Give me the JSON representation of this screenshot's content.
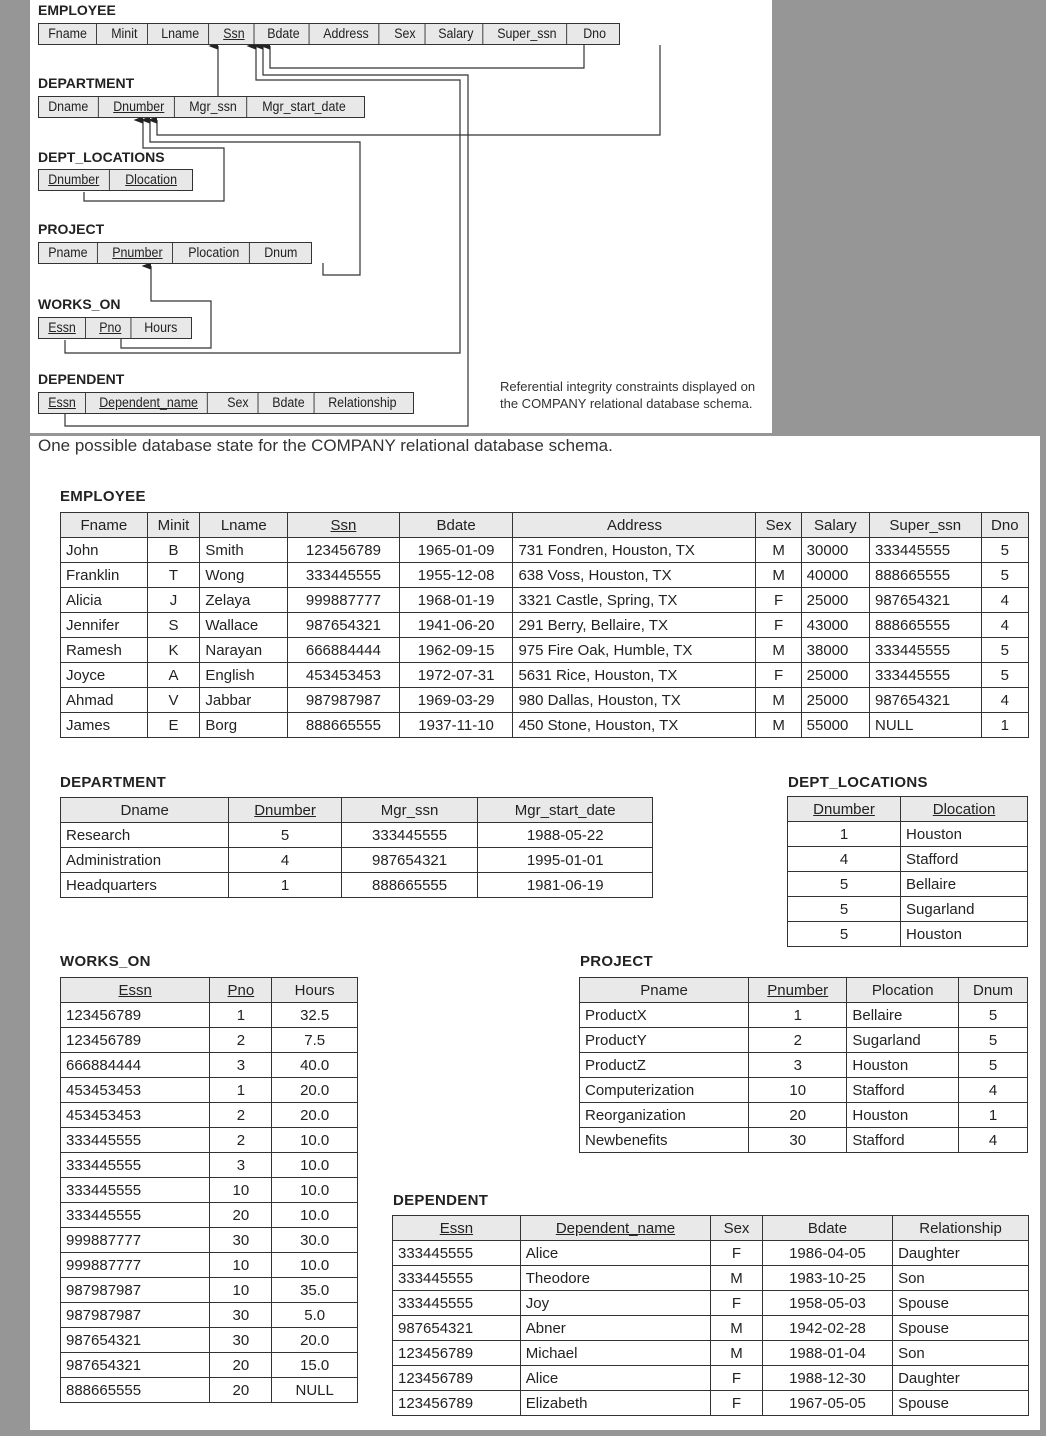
{
  "schema": {
    "caption": "Referential integrity constraints displayed on the COMPANY relational database schema.",
    "relations": [
      {
        "name": "EMPLOYEE",
        "attributes": [
          "Fname",
          "Minit",
          "Lname",
          "Ssn",
          "Bdate",
          "Address",
          "Sex",
          "Salary",
          "Super_ssn",
          "Dno"
        ],
        "keys": [
          "Ssn"
        ]
      },
      {
        "name": "DEPARTMENT",
        "attributes": [
          "Dname",
          "Dnumber",
          "Mgr_ssn",
          "Mgr_start_date"
        ],
        "keys": [
          "Dnumber"
        ]
      },
      {
        "name": "DEPT_LOCATIONS",
        "attributes": [
          "Dnumber",
          "Dlocation"
        ],
        "keys": [
          "Dnumber",
          "Dlocation"
        ]
      },
      {
        "name": "PROJECT",
        "attributes": [
          "Pname",
          "Pnumber",
          "Plocation",
          "Dnum"
        ],
        "keys": [
          "Pnumber"
        ]
      },
      {
        "name": "WORKS_ON",
        "attributes": [
          "Essn",
          "Pno",
          "Hours"
        ],
        "keys": [
          "Essn",
          "Pno"
        ]
      },
      {
        "name": "DEPENDENT",
        "attributes": [
          "Essn",
          "Dependent_name",
          "Sex",
          "Bdate",
          "Relationship"
        ],
        "keys": [
          "Essn",
          "Dependent_name"
        ]
      }
    ]
  },
  "state": {
    "caption": "One possible database state for the COMPANY relational database schema.",
    "employee": {
      "title": "EMPLOYEE",
      "headers": [
        "Fname",
        "Minit",
        "Lname",
        "Ssn",
        "Bdate",
        "Address",
        "Sex",
        "Salary",
        "Super_ssn",
        "Dno"
      ],
      "rows": [
        [
          "John",
          "B",
          "Smith",
          "123456789",
          "1965-01-09",
          "731 Fondren, Houston, TX",
          "M",
          "30000",
          "333445555",
          "5"
        ],
        [
          "Franklin",
          "T",
          "Wong",
          "333445555",
          "1955-12-08",
          "638 Voss, Houston, TX",
          "M",
          "40000",
          "888665555",
          "5"
        ],
        [
          "Alicia",
          "J",
          "Zelaya",
          "999887777",
          "1968-01-19",
          "3321 Castle, Spring, TX",
          "F",
          "25000",
          "987654321",
          "4"
        ],
        [
          "Jennifer",
          "S",
          "Wallace",
          "987654321",
          "1941-06-20",
          "291 Berry, Bellaire, TX",
          "F",
          "43000",
          "888665555",
          "4"
        ],
        [
          "Ramesh",
          "K",
          "Narayan",
          "666884444",
          "1962-09-15",
          "975 Fire Oak, Humble, TX",
          "M",
          "38000",
          "333445555",
          "5"
        ],
        [
          "Joyce",
          "A",
          "English",
          "453453453",
          "1972-07-31",
          "5631 Rice, Houston, TX",
          "F",
          "25000",
          "333445555",
          "5"
        ],
        [
          "Ahmad",
          "V",
          "Jabbar",
          "987987987",
          "1969-03-29",
          "980 Dallas, Houston, TX",
          "M",
          "25000",
          "987654321",
          "4"
        ],
        [
          "James",
          "E",
          "Borg",
          "888665555",
          "1937-11-10",
          "450 Stone, Houston, TX",
          "M",
          "55000",
          "NULL",
          "1"
        ]
      ]
    },
    "department": {
      "title": "DEPARTMENT",
      "headers": [
        "Dname",
        "Dnumber",
        "Mgr_ssn",
        "Mgr_start_date"
      ],
      "rows": [
        [
          "Research",
          "5",
          "333445555",
          "1988-05-22"
        ],
        [
          "Administration",
          "4",
          "987654321",
          "1995-01-01"
        ],
        [
          "Headquarters",
          "1",
          "888665555",
          "1981-06-19"
        ]
      ]
    },
    "dept_locations": {
      "title": "DEPT_LOCATIONS",
      "headers": [
        "Dnumber",
        "Dlocation"
      ],
      "rows": [
        [
          "1",
          "Houston"
        ],
        [
          "4",
          "Stafford"
        ],
        [
          "5",
          "Bellaire"
        ],
        [
          "5",
          "Sugarland"
        ],
        [
          "5",
          "Houston"
        ]
      ]
    },
    "works_on": {
      "title": "WORKS_ON",
      "headers": [
        "Essn",
        "Pno",
        "Hours"
      ],
      "rows": [
        [
          "123456789",
          "1",
          "32.5"
        ],
        [
          "123456789",
          "2",
          "7.5"
        ],
        [
          "666884444",
          "3",
          "40.0"
        ],
        [
          "453453453",
          "1",
          "20.0"
        ],
        [
          "453453453",
          "2",
          "20.0"
        ],
        [
          "333445555",
          "2",
          "10.0"
        ],
        [
          "333445555",
          "3",
          "10.0"
        ],
        [
          "333445555",
          "10",
          "10.0"
        ],
        [
          "333445555",
          "20",
          "10.0"
        ],
        [
          "999887777",
          "30",
          "30.0"
        ],
        [
          "999887777",
          "10",
          "10.0"
        ],
        [
          "987987987",
          "10",
          "35.0"
        ],
        [
          "987987987",
          "30",
          "5.0"
        ],
        [
          "987654321",
          "30",
          "20.0"
        ],
        [
          "987654321",
          "20",
          "15.0"
        ],
        [
          "888665555",
          "20",
          "NULL"
        ]
      ]
    },
    "project": {
      "title": "PROJECT",
      "headers": [
        "Pname",
        "Pnumber",
        "Plocation",
        "Dnum"
      ],
      "rows": [
        [
          "ProductX",
          "1",
          "Bellaire",
          "5"
        ],
        [
          "ProductY",
          "2",
          "Sugarland",
          "5"
        ],
        [
          "ProductZ",
          "3",
          "Houston",
          "5"
        ],
        [
          "Computerization",
          "10",
          "Stafford",
          "4"
        ],
        [
          "Reorganization",
          "20",
          "Houston",
          "1"
        ],
        [
          "Newbenefits",
          "30",
          "Stafford",
          "4"
        ]
      ]
    },
    "dependent": {
      "title": "DEPENDENT",
      "headers": [
        "Essn",
        "Dependent_name",
        "Sex",
        "Bdate",
        "Relationship"
      ],
      "rows": [
        [
          "333445555",
          "Alice",
          "F",
          "1986-04-05",
          "Daughter"
        ],
        [
          "333445555",
          "Theodore",
          "M",
          "1983-10-25",
          "Son"
        ],
        [
          "333445555",
          "Joy",
          "F",
          "1958-05-03",
          "Spouse"
        ],
        [
          "987654321",
          "Abner",
          "M",
          "1942-02-28",
          "Spouse"
        ],
        [
          "123456789",
          "Michael",
          "M",
          "1988-01-04",
          "Son"
        ],
        [
          "123456789",
          "Alice",
          "F",
          "1988-12-30",
          "Daughter"
        ],
        [
          "123456789",
          "Elizabeth",
          "F",
          "1967-05-05",
          "Spouse"
        ]
      ]
    }
  }
}
